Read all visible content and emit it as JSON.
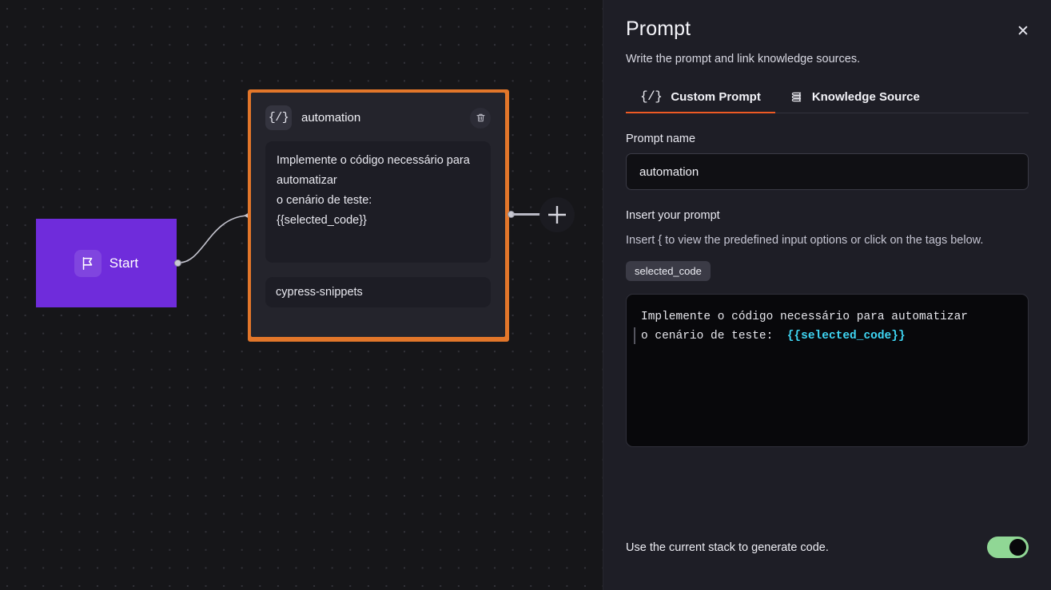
{
  "canvas": {
    "start_node": {
      "label": "Start",
      "icon": "flag-icon",
      "color": "#6f2cdb"
    },
    "prompt_node": {
      "icon": "curly-brace-slash-icon",
      "title": "automation",
      "delete_icon": "trash-icon",
      "prompt_text": "Implemente o código necessário para automatizar\n o cenário de teste:\n{{selected_code}}",
      "tag": "cypress-snippets",
      "selected_border_color": "#e2762a"
    },
    "add_button": {
      "icon": "plus-icon",
      "label": "+"
    }
  },
  "panel": {
    "title": "Prompt",
    "subtitle": "Write the prompt and link knowledge sources.",
    "close_icon": "close-icon",
    "close_label": "✕",
    "tabs": [
      {
        "label": "Custom Prompt",
        "icon": "curly-brace-slash-icon",
        "glyph": "{/}",
        "active": true
      },
      {
        "label": "Knowledge Source",
        "icon": "stacked-books-icon",
        "glyph": "",
        "active": false
      }
    ],
    "accent_color": "#ee5a24",
    "prompt_name": {
      "label": "Prompt name",
      "value": "automation",
      "placeholder": "Prompt name"
    },
    "insert_prompt": {
      "label": "Insert your prompt",
      "hint": "Insert { to view the predefined input options or click on the tags below."
    },
    "tags": [
      "selected_code"
    ],
    "editor": {
      "line1": "Implemente o código necessário para automatizar",
      "line2_prefix": "o cenário de teste:  ",
      "line2_var": "{{selected_code}}",
      "var_color": "#3fd6f4"
    },
    "stack_toggle": {
      "label": "Use the current stack to generate code.",
      "state": "on",
      "on_color": "#90d795"
    }
  }
}
